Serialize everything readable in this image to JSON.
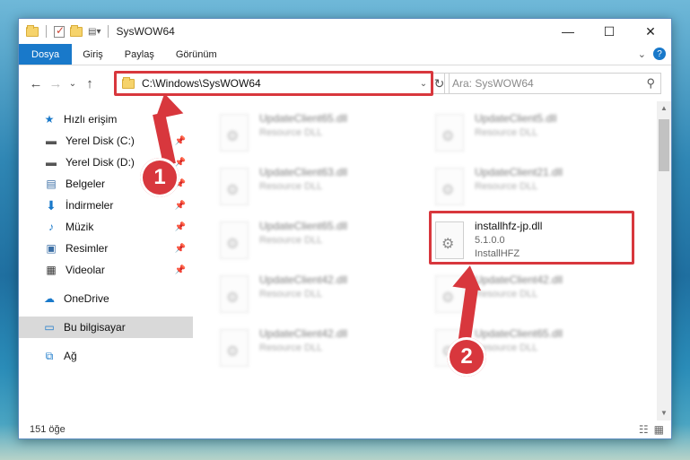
{
  "window": {
    "title": "SysWOW64",
    "minimize": "—",
    "maximize": "☐",
    "close": "✕"
  },
  "ribbon": {
    "tabs": [
      "Dosya",
      "Giriş",
      "Paylaş",
      "Görünüm"
    ],
    "expand": "⌄"
  },
  "navbar": {
    "back": "←",
    "forward": "→",
    "recent": "⌄",
    "up": "↑",
    "address": "C:\\Windows\\SysWOW64",
    "search_placeholder": "Ara: SysWOW64"
  },
  "sidebar": {
    "quick_access": "Hızlı erişim",
    "items": [
      {
        "label": "Yerel Disk (C:)",
        "icon": "drive-icon"
      },
      {
        "label": "Yerel Disk (D:)",
        "icon": "drive-icon"
      },
      {
        "label": "Belgeler",
        "icon": "documents-icon"
      },
      {
        "label": "İndirmeler",
        "icon": "download-icon"
      },
      {
        "label": "Müzik",
        "icon": "music-icon"
      },
      {
        "label": "Resimler",
        "icon": "pictures-icon"
      },
      {
        "label": "Videolar",
        "icon": "videos-icon"
      }
    ],
    "onedrive": "OneDrive",
    "this_pc": "Bu bilgisayar",
    "network": "Ağ"
  },
  "files": [
    {
      "name": "UpdateClient65.dll",
      "type": "Resource DLL",
      "blurred": true
    },
    {
      "name": "UpdateClient5.dll",
      "type": "Resource DLL",
      "blurred": true
    },
    {
      "name": "UpdateClient63.dll",
      "type": "Resource DLL",
      "blurred": true
    },
    {
      "name": "UpdateClient21.dll",
      "type": "Resource DLL",
      "blurred": true
    },
    {
      "name": "UpdateClient65.dll",
      "type": "Resource DLL",
      "blurred": true
    },
    {
      "name": "installhfz-jp.dll",
      "version": "5.1.0.0",
      "type": "InstallHFZ",
      "blurred": false
    },
    {
      "name": "UpdateClient42.dll",
      "type": "Resource DLL",
      "blurred": true
    },
    {
      "name": "UpdateClient42.dll",
      "type": "Resource DLL",
      "blurred": true
    },
    {
      "name": "UpdateClient42.dll",
      "type": "Resource DLL",
      "blurred": true
    },
    {
      "name": "UpdateClient65.dll",
      "type": "Resource DLL",
      "blurred": true
    }
  ],
  "status": {
    "count": "151 öğe"
  },
  "annotations": {
    "step1": "1",
    "step2": "2",
    "color": "#d8373d"
  }
}
